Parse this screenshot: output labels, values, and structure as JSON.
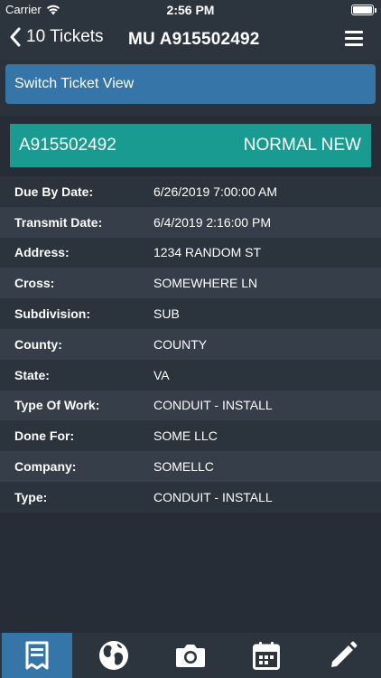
{
  "status": {
    "carrier": "Carrier",
    "time": "2:56 PM",
    "battery_level": 1.0
  },
  "nav": {
    "back_label": "10 Tickets",
    "title": "MU A915502492"
  },
  "switch_view_label": "Switch Ticket View",
  "ticket": {
    "number": "A915502492",
    "type": "NORMAL NEW"
  },
  "details": [
    {
      "label": "Due By Date:",
      "value": "6/26/2019 7:00:00 AM"
    },
    {
      "label": "Transmit Date:",
      "value": "6/4/2019 2:16:00 PM"
    },
    {
      "label": "Address:",
      "value": "1234 RANDOM ST"
    },
    {
      "label": "Cross:",
      "value": "SOMEWHERE LN"
    },
    {
      "label": "Subdivision:",
      "value": "SUB"
    },
    {
      "label": "County:",
      "value": "COUNTY"
    },
    {
      "label": "State:",
      "value": "VA"
    },
    {
      "label": "Type Of Work:",
      "value": "CONDUIT - INSTALL"
    },
    {
      "label": "Done For:",
      "value": "SOME LLC"
    },
    {
      "label": "Company:",
      "value": "SOMELLC"
    },
    {
      "label": "Type:",
      "value": "CONDUIT - INSTALL"
    }
  ],
  "tabs": [
    {
      "icon": "ticket-icon",
      "active": true
    },
    {
      "icon": "globe-icon",
      "active": false
    },
    {
      "icon": "camera-icon",
      "active": false
    },
    {
      "icon": "calendar-icon",
      "active": false
    },
    {
      "icon": "pencil-icon",
      "active": false
    }
  ],
  "colors": {
    "accent": "#3575a8",
    "banner": "#1a9b91",
    "background": "#2a323c"
  }
}
